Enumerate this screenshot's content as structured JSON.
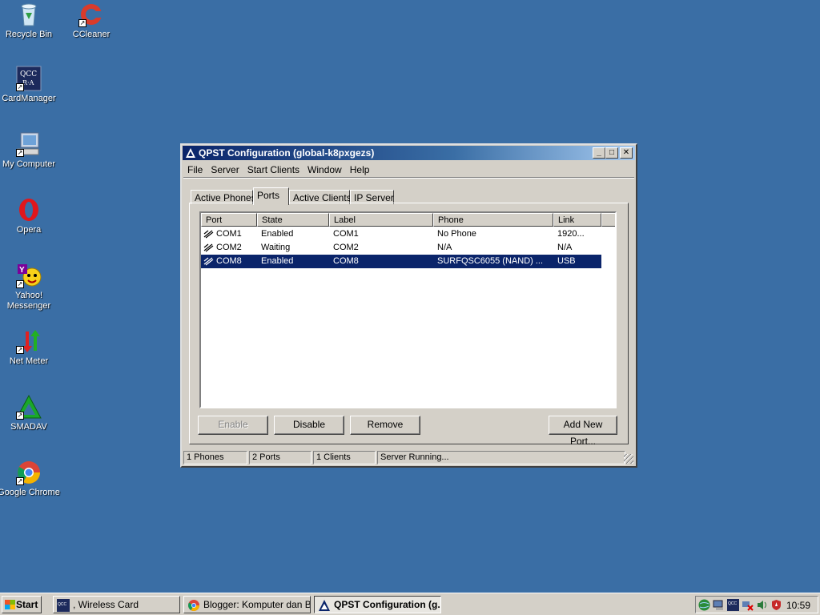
{
  "desktop": {
    "icons": [
      {
        "label": "Recycle Bin"
      },
      {
        "label": "CCleaner"
      },
      {
        "label": "CardManager"
      },
      {
        "label": "My Computer"
      },
      {
        "label": "Opera"
      },
      {
        "label": "Yahoo!\nMessenger"
      },
      {
        "label": "Net Meter"
      },
      {
        "label": "SMADAV"
      },
      {
        "label": "Google Chrome"
      }
    ]
  },
  "window": {
    "title": "QPST Configuration (global-k8pxgezs)",
    "menu": [
      "File",
      "Server",
      "Start Clients",
      "Window",
      "Help"
    ],
    "tabs": [
      "Active Phones",
      "Ports",
      "Active Clients",
      "IP Server"
    ],
    "active_tab": "Ports",
    "columns": [
      "Port",
      "State",
      "Label",
      "Phone",
      "Link"
    ],
    "rows": [
      {
        "port": "COM1",
        "state": "Enabled",
        "label": "COM1",
        "phone": "No Phone",
        "link": "1920..."
      },
      {
        "port": "COM2",
        "state": "Waiting",
        "label": "COM2",
        "phone": "N/A",
        "link": "N/A"
      },
      {
        "port": "COM8",
        "state": "Enabled",
        "label": "COM8",
        "phone": "SURFQSC6055 (NAND) ...",
        "link": "USB"
      }
    ],
    "selected_row": 2,
    "buttons": {
      "enable": "Enable",
      "disable": "Disable",
      "remove": "Remove",
      "add_new_port": "Add New Port..."
    },
    "status": [
      "1 Phones",
      "2 Ports",
      "1 Clients",
      "Server Running..."
    ]
  },
  "taskbar": {
    "start_label": "Start",
    "tasks": [
      {
        "label": ", Wireless Card"
      },
      {
        "label": "Blogger: Komputer dan B..."
      },
      {
        "label": "QPST Configuration (g..."
      }
    ],
    "clock": "10:59"
  },
  "colors": {
    "desktop": "#3a6ea5",
    "title_active": "#0a246a",
    "selection": "#0a246a"
  }
}
